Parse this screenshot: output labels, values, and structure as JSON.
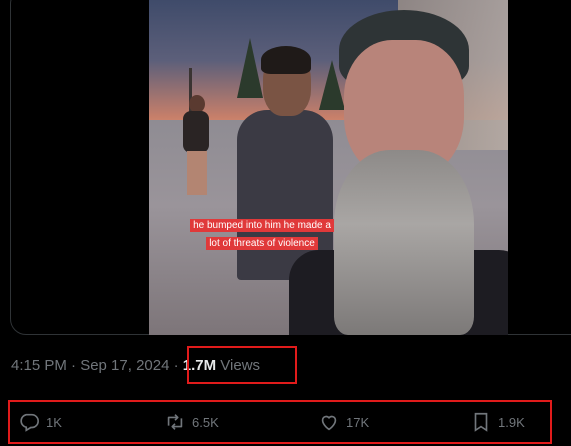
{
  "video": {
    "caption": "he bumped into him he made a lot of threats of violence"
  },
  "meta": {
    "timestamp": "4:15 PM · Sep 17, 2024 · ",
    "views_count": "1.7M",
    "views_label": " Views"
  },
  "actions": {
    "reply_count": "1K",
    "repost_count": "6.5K",
    "like_count": "17K",
    "bookmark_count": "1.9K"
  },
  "colors": {
    "highlight_box": "#e11b1b",
    "muted_text": "#71767b",
    "caption_bg": "#e0393a"
  }
}
